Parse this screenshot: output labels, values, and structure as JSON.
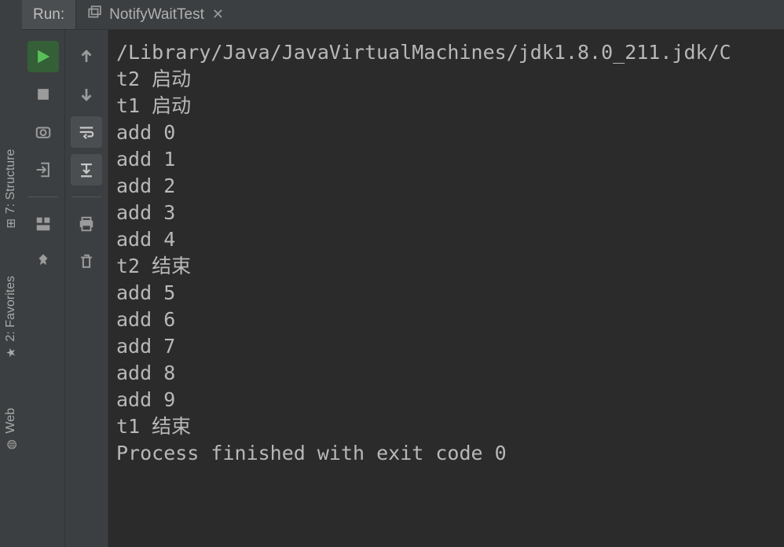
{
  "header": {
    "run_label": "Run:",
    "tab_name": "NotifyWaitTest"
  },
  "left_tabs": {
    "structure": "7: Structure",
    "favorites": "2: Favorites",
    "web": "Web"
  },
  "console_lines": [
    "/Library/Java/JavaVirtualMachines/jdk1.8.0_211.jdk/C",
    "t2 启动",
    "t1 启动",
    "add 0",
    "add 1",
    "add 2",
    "add 3",
    "add 4",
    "t2 结束",
    "add 5",
    "add 6",
    "add 7",
    "add 8",
    "add 9",
    "t1 结束",
    "",
    "Process finished with exit code 0"
  ]
}
